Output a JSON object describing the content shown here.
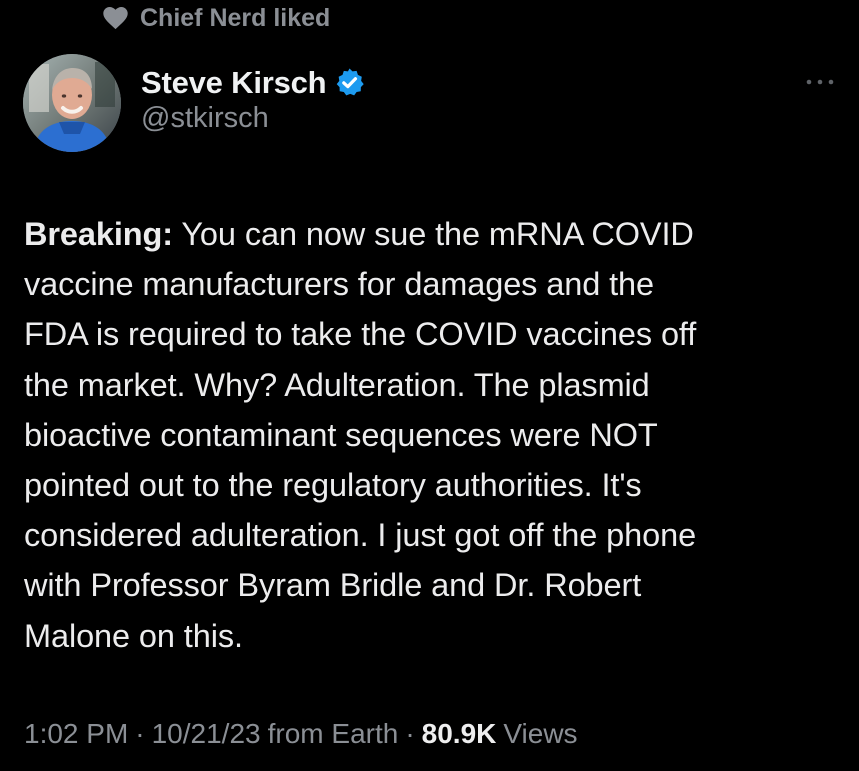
{
  "social_context": {
    "icon": "heart-icon",
    "text": "Chief Nerd liked"
  },
  "author": {
    "name": "Steve Kirsch",
    "verified_icon": "verified-badge-icon",
    "handle": "@stkirsch",
    "avatar_icon": "user-avatar"
  },
  "tweet": {
    "lead": "Breaking:",
    "lines": [
      " You can now sue the mRNA COVID",
      "vaccine manufacturers for damages and the",
      "FDA is required to take the COVID vaccines off",
      "the market. Why? Adulteration. The plasmid",
      "bioactive contaminant sequences were NOT",
      "pointed out to the regulatory authorities. It's",
      "considered adulteration. I just got off the phone",
      "with Professor Byram Bridle and Dr. Robert",
      "Malone on this."
    ]
  },
  "meta": {
    "time": "1:02 PM",
    "date": "10/21/23",
    "source": "from Earth",
    "separator": "·",
    "views_count": "80.9K",
    "views_label": "Views"
  },
  "actions": {
    "more_icon": "more-options-icon"
  },
  "colors": {
    "background": "#000000",
    "text": "#e7e9ea",
    "muted": "#8b8f95",
    "verified": "#1d9bf0"
  }
}
